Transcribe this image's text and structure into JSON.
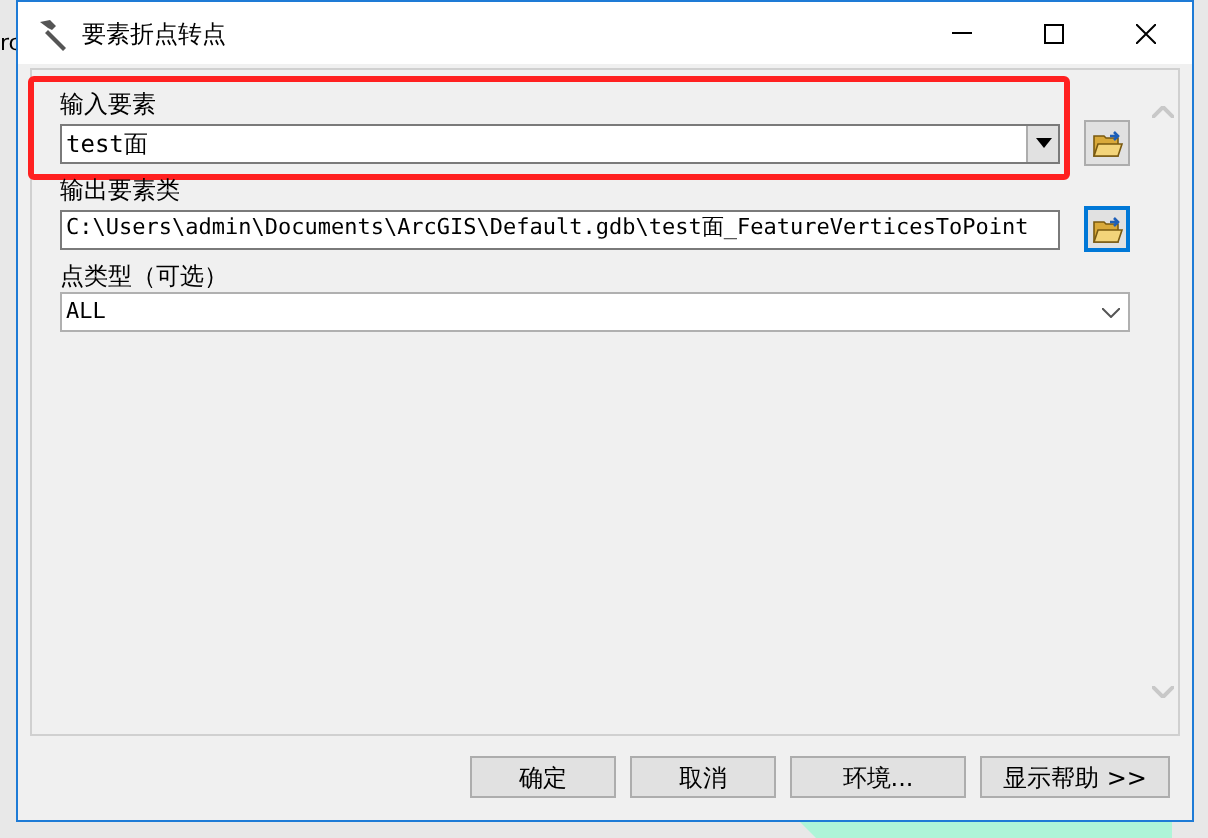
{
  "background_text": "rc",
  "window": {
    "title": "要素折点转点"
  },
  "fields": [
    {
      "kind": "combo",
      "label": "输入要素",
      "value": "test面",
      "highlighted": true,
      "browse_focused": false
    },
    {
      "kind": "text",
      "label": "输出要素类",
      "value": "C:\\Users\\admin\\Documents\\ArcGIS\\Default.gdb\\test面_FeatureVerticesToPoint",
      "highlighted": false,
      "browse_focused": true
    },
    {
      "kind": "select",
      "label": "点类型（可选）",
      "value": "ALL",
      "highlighted": false
    }
  ],
  "buttons": [
    "确定",
    "取消",
    "环境...",
    "显示帮助 >>"
  ]
}
